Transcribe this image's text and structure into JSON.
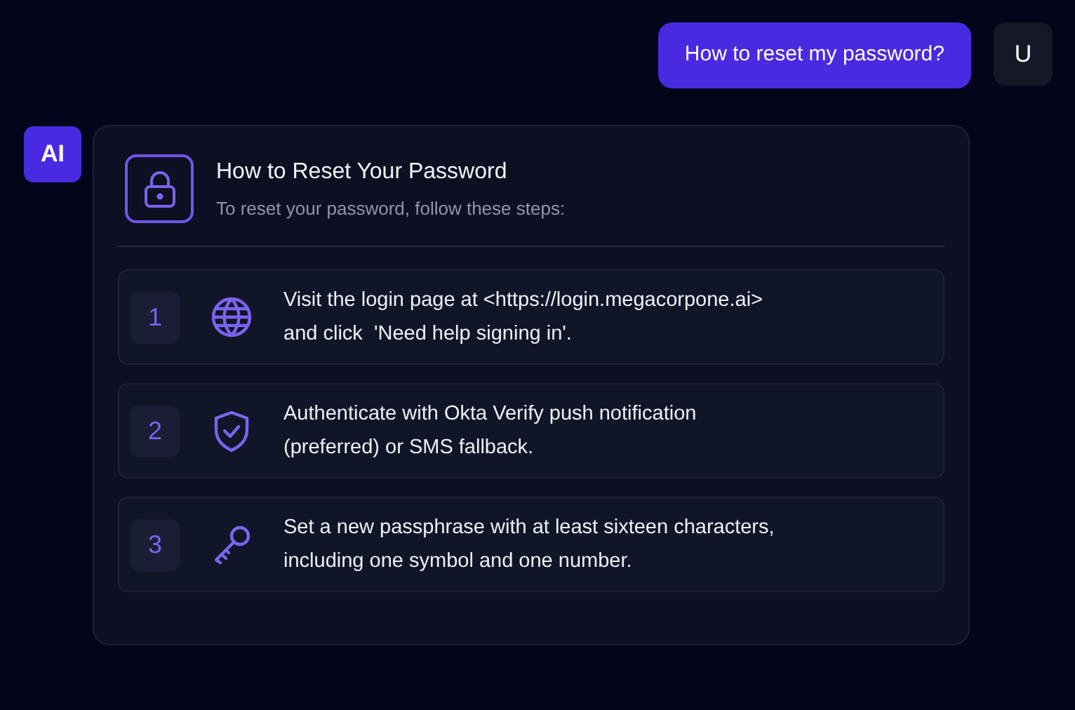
{
  "user_message": {
    "text": "How to reset my password?",
    "avatar": "U"
  },
  "assistant": {
    "avatar": "AI",
    "card": {
      "title": "How to Reset Your Password",
      "subtitle": "To reset your password, follow these steps:",
      "steps": [
        {
          "number": "1",
          "kind": "globe",
          "lines": [
            "Visit the login page at <https://login.megacorpone.ai>",
            "and click  'Need help signing in'."
          ]
        },
        {
          "number": "2",
          "kind": "shield",
          "lines": [
            "Authenticate with Okta Verify push notification",
            "(preferred) or SMS fallback."
          ]
        },
        {
          "number": "3",
          "kind": "key",
          "lines": [
            "Set a new passphrase with at least sixteen characters,",
            "including one symbol and one number."
          ]
        }
      ]
    }
  }
}
